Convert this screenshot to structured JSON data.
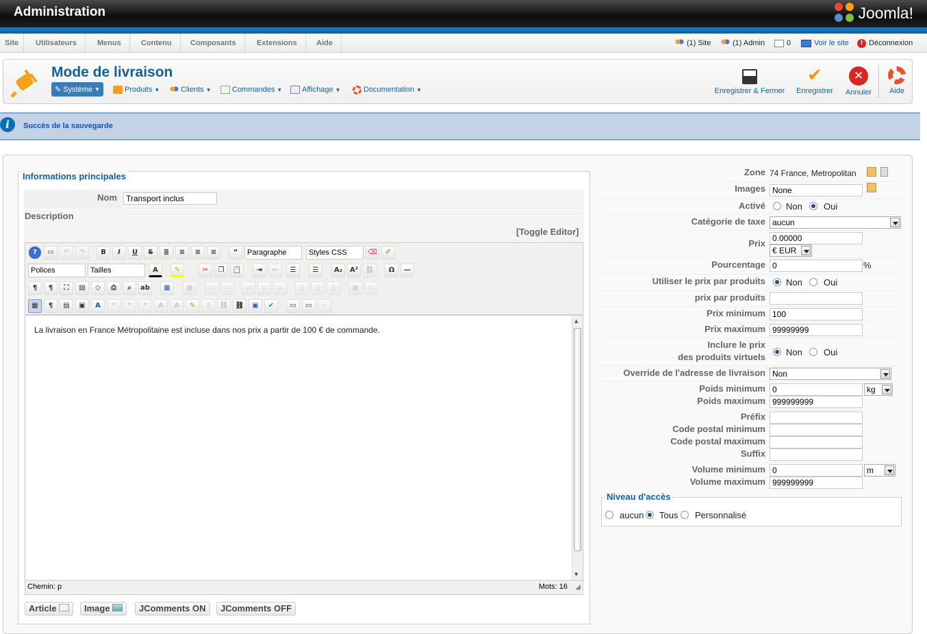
{
  "header": {
    "title": "Administration",
    "logo_text": "Joomla!"
  },
  "menu": [
    "Site",
    "Utilisateurs",
    "Menus",
    "Contenu",
    "Composants",
    "Extensions",
    "Aide"
  ],
  "status": {
    "site": "(1) Site",
    "admin": "(1) Admin",
    "messages": "0",
    "view_site": "Voir le site",
    "logout": "Déconnexion"
  },
  "page": {
    "title": "Mode de livraison"
  },
  "subnav": [
    "Système",
    "Produits",
    "Clients",
    "Commandes",
    "Affichage",
    "Documentation"
  ],
  "toolbar": {
    "save_close": "Enregistrer & Fermer",
    "save": "Enregistrer",
    "cancel": "Annuler",
    "help": "Aide"
  },
  "message": "Succès de la sauvegarde",
  "main": {
    "legend": "Informations principales",
    "name_label": "Nom",
    "name_value": "Transport inclus",
    "description_label": "Description",
    "toggle_editor": "[Toggle Editor]",
    "editor": {
      "format": "Paragraphe",
      "styles": "Styles CSS",
      "fonts": "Polices",
      "sizes": "Tailles",
      "content": "La livraison en France Métropolitaine est incluse dans nos prix a partir de 100 € de commande.",
      "path": "Chemin: p",
      "words": "Mots: 16"
    },
    "buttons": [
      "Article",
      "Image",
      "JComments ON",
      "JComments OFF"
    ]
  },
  "side": {
    "zone_label": "Zone",
    "zone_value": "74 France, Metropolitan",
    "images_label": "Images",
    "images_value": "None",
    "active_label": "Activé",
    "no": "Non",
    "yes": "Oui",
    "tax_label": "Catégorie de taxe",
    "tax_value": "aucun",
    "price_label": "Prix",
    "price_value": "0.00000",
    "currency": "€ EUR",
    "percent_label": "Pourcentage",
    "percent_value": "0",
    "percent_sign": "%",
    "per_product_label": "Utiliser le prix par produits",
    "price_per_product_label": "prix par produits",
    "price_per_product_value": "",
    "min_price_label": "Prix minimum",
    "min_price_value": "100",
    "max_price_label": "Prix maximum",
    "max_price_value": "99999999",
    "virtual_label_1": "Inclure le prix",
    "virtual_label_2": "des produits virtuels",
    "override_label": "Override de l'adresse de livraison",
    "override_value": "Non",
    "min_weight_label": "Poids minimum",
    "min_weight_value": "0",
    "weight_unit": "kg",
    "max_weight_label": "Poids maximum",
    "max_weight_value": "999999999",
    "prefix_label": "Préfix",
    "zip_min_label": "Code postal minimum",
    "zip_max_label": "Code postal maximum",
    "suffix_label": "Suffix",
    "min_volume_label": "Volume minimum",
    "min_volume_value": "0",
    "volume_unit": "m",
    "max_volume_label": "Volume maximum",
    "max_volume_value": "999999999",
    "access_legend": "Niveau d'accès",
    "access_none": "aucun",
    "access_all": "Tous",
    "access_custom": "Personnalisé"
  },
  "colors": {
    "accent": "#146295",
    "topbar": "#111111",
    "message_bg": "#c3d2e5"
  }
}
